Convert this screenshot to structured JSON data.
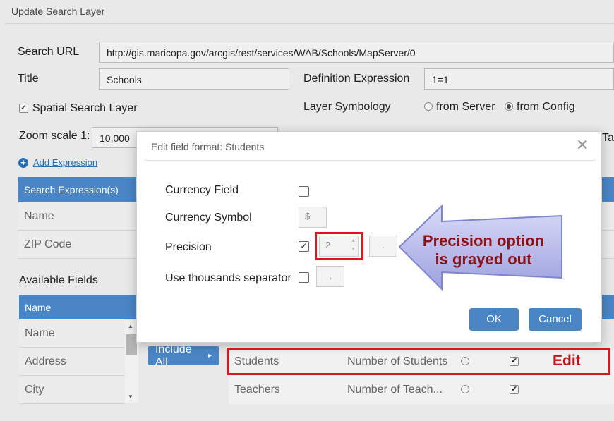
{
  "page": {
    "title": "Update Search Layer",
    "search_url_label": "Search URL",
    "search_url_value": "http://gis.maricopa.gov/arcgis/rest/services/WAB/Schools/MapServer/0",
    "title_label": "Title",
    "title_value": "Schools",
    "def_expr_label": "Definition Expression",
    "def_expr_value": "1=1",
    "spatial_label": "Spatial Search Layer",
    "spatial_checked": "✓",
    "symbology_label": "Layer Symbology",
    "from_server": "from Server",
    "from_config": "from Config",
    "zoom_label": "Zoom scale 1:",
    "zoom_value": "10,000",
    "ta_fragment": "Ta",
    "add_expression": "Add Expression",
    "search_expr_header": "Search Expression(s)",
    "search_expr_rows": [
      "Name",
      "ZIP Code"
    ],
    "available_fields_label": "Available Fields",
    "fields_header": "Name",
    "field_rows": [
      "Name",
      "Address",
      "City"
    ],
    "include_all": "Include All",
    "include_arrow": "▸",
    "grid_rows": [
      {
        "field": "Students",
        "alias": "Number of Students",
        "checked": "✔"
      },
      {
        "field": "Teachers",
        "alias": "Number of Teach...",
        "checked": "✔"
      }
    ]
  },
  "dialog": {
    "title": "Edit field format: Students",
    "close_glyph": "✕",
    "currency_field_label": "Currency Field",
    "currency_symbol_label": "Currency Symbol",
    "currency_symbol_value": "$",
    "precision_label": "Precision",
    "precision_checked": "✓",
    "precision_value": "2",
    "decimal_separator": ".",
    "thousands_label": "Use thousands separator",
    "thousands_value": ",",
    "ok": "OK",
    "cancel": "Cancel"
  },
  "annotations": {
    "callout_line1": "Precision option",
    "callout_line2": "is grayed out",
    "edit_note": "Edit",
    "accent_red": "#e0161b",
    "arrow_fill": "#b7b9ea"
  }
}
